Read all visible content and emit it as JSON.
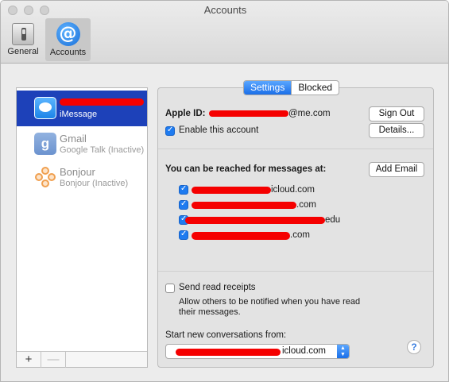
{
  "window": {
    "title": "Accounts"
  },
  "toolbar": {
    "general_label": "General",
    "accounts_label": "Accounts",
    "accounts_icon_glyph": "@"
  },
  "sidebar": {
    "accounts": [
      {
        "name": "",
        "subtitle": "iMessage",
        "icon": "messages-icon",
        "selected": true
      },
      {
        "name": "Gmail",
        "subtitle": "Google Talk (Inactive)",
        "icon": "gmail-icon",
        "icon_glyph": "g",
        "selected": false
      },
      {
        "name": "Bonjour",
        "subtitle": "Bonjour (Inactive)",
        "icon": "bonjour-icon",
        "selected": false
      }
    ],
    "add_label": "+",
    "remove_label": "—"
  },
  "tabs": {
    "settings": "Settings",
    "blocked": "Blocked"
  },
  "account": {
    "apple_id_label": "Apple ID:",
    "apple_id_value_visible": "@me.com",
    "sign_out": "Sign Out",
    "enable_label": "Enable this account",
    "enable_checked": true,
    "details": "Details..."
  },
  "reach": {
    "label": "You can be reached for messages at:",
    "add_email": "Add Email",
    "addresses": [
      {
        "visible_text": "icloud.com",
        "checked": true
      },
      {
        "visible_text": ".com",
        "checked": true
      },
      {
        "visible_text": "edu",
        "checked": true
      },
      {
        "visible_text": ".com",
        "checked": true
      }
    ]
  },
  "receipts": {
    "label": "Send read receipts",
    "checked": false,
    "description_line1": "Allow others to be notified when you have read",
    "description_line2": "their messages."
  },
  "conversations": {
    "label": "Start new conversations from:",
    "selected_visible": "icloud.com"
  },
  "help_label": "?",
  "colors": {
    "accent": "#1b6fe8",
    "selection": "#1d41b9",
    "redaction": "#f50000"
  }
}
